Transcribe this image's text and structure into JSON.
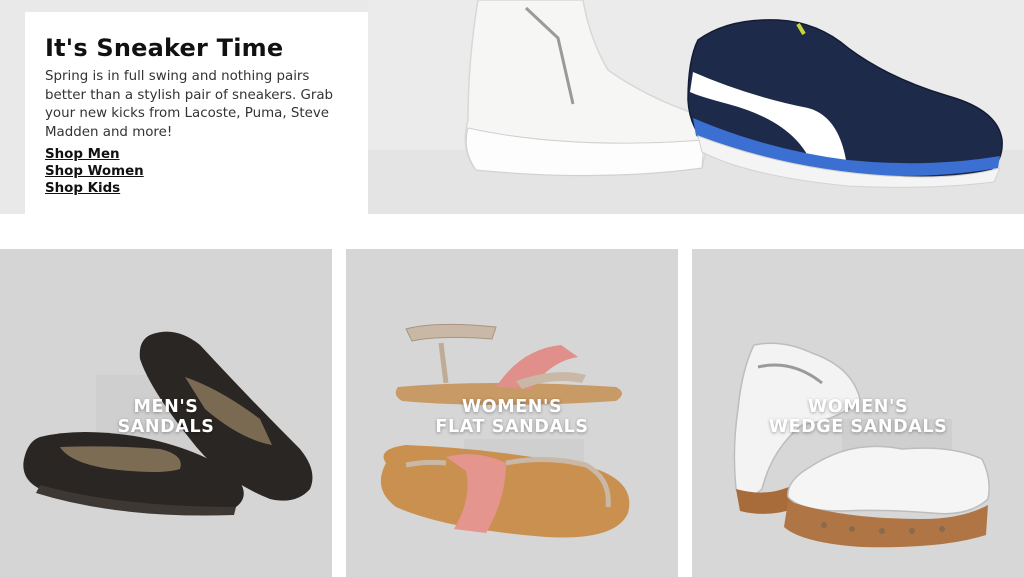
{
  "hero": {
    "title": "It's Sneaker Time",
    "copy": "Spring is in full swing and nothing pairs better than a stylish pair of sneakers. Grab your new kicks from Lacoste, Puma, Steve Madden and more!",
    "links": [
      "Shop Men",
      "Shop Women",
      "Shop Kids"
    ]
  },
  "tiles": [
    {
      "line1": "MEN'S",
      "line2": "SANDALS",
      "icon": "mens-sandals-image"
    },
    {
      "line1": "WOMEN'S",
      "line2": "FLAT SANDALS",
      "icon": "womens-flat-sandals-image"
    },
    {
      "line1": "WOMEN'S",
      "line2": "WEDGE SANDALS",
      "icon": "womens-wedge-sandals-image"
    }
  ],
  "colors": {
    "hero_bg": "#e9e9ea",
    "tile_bg": "#d6d6d6",
    "text": "#111111"
  }
}
